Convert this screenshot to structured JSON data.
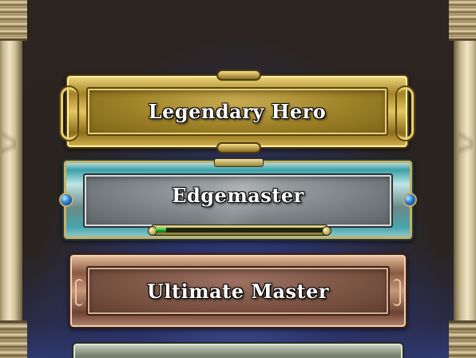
{
  "menu": {
    "items": [
      {
        "label": "Legendary Hero",
        "tier": "gold",
        "selected": false
      },
      {
        "label": "Edgemaster",
        "tier": "silver",
        "selected": true,
        "progress": 0.06
      },
      {
        "label": "Ultimate Master",
        "tier": "bronze",
        "selected": false
      }
    ],
    "partial_item_visible": true
  },
  "colors": {
    "gold": "#b8962e",
    "silver": "#7c8286",
    "silver_trim": "#3aa0a8",
    "bronze": "#7c5444",
    "progress_fill": "#1aa028",
    "gem": "#2a7ed8"
  }
}
